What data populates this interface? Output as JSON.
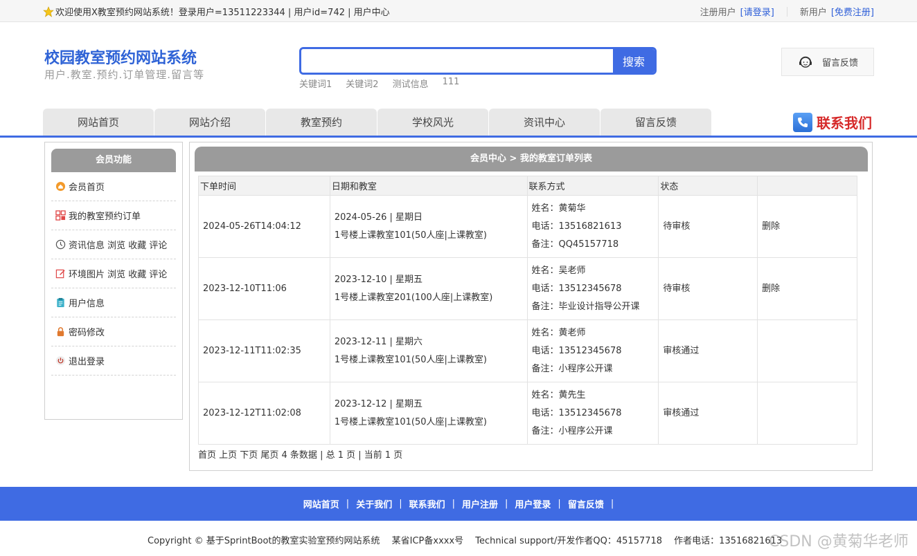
{
  "topbar": {
    "welcome": "欢迎使用X教室预约网站系统！登录用户=13511223344 | 用户id=742 | 用户中心",
    "register_user_label": "注册用户",
    "login_link": "[请登录]",
    "new_user_label": "新用户",
    "register_link": "[免费注册]"
  },
  "header": {
    "title": "校园教室预约网站系统",
    "subtitle": "用户.教室.预约.订单管理.留言等",
    "search": {
      "placeholder": "",
      "button": "搜索"
    },
    "keywords": [
      "关键词1",
      "关键词2",
      "测试信息",
      "111"
    ],
    "feedback": "留言反馈"
  },
  "nav": {
    "items": [
      "网站首页",
      "网站介绍",
      "教室预约",
      "学校风光",
      "资讯中心",
      "留言反馈"
    ],
    "contact": "联系我们"
  },
  "sidebar": {
    "title": "会员功能",
    "items": [
      {
        "label": "会员首页",
        "icon": "home-icon"
      },
      {
        "label": "我的教室预约订单",
        "icon": "orders-icon"
      },
      {
        "label": "资讯信息 浏览 收藏 评论",
        "icon": "clock-icon"
      },
      {
        "label": "环境图片 浏览 收藏 评论",
        "icon": "edit-icon"
      },
      {
        "label": "用户信息",
        "icon": "clipboard-icon"
      },
      {
        "label": "密码修改",
        "icon": "lock-icon"
      },
      {
        "label": "退出登录",
        "icon": "power-icon"
      }
    ]
  },
  "main": {
    "title": "会员中心 > 我的教室订单列表",
    "columns": [
      "下单时间",
      "日期和教室",
      "联系方式",
      "状态",
      ""
    ],
    "rows": [
      {
        "time": "2024-05-26T14:04:12",
        "date": "2024-05-26 | 星期日",
        "room": "1号楼上课教室101(50人座|上课教室)",
        "name": "姓名：黄菊华",
        "phone": "电话：13516821613",
        "note": "备注：QQ45157718",
        "status": "待审核",
        "action": "删除"
      },
      {
        "time": "2023-12-10T11:06",
        "date": "2023-12-10 | 星期五",
        "room": "1号楼上课教室201(100人座|上课教室)",
        "name": "姓名：吴老师",
        "phone": "电话：13512345678",
        "note": "备注：毕业设计指导公开课",
        "status": "待审核",
        "action": "删除"
      },
      {
        "time": "2023-12-11T11:02:35",
        "date": "2023-12-11 | 星期六",
        "room": "1号楼上课教室101(50人座|上课教室)",
        "name": "姓名：黄老师",
        "phone": "电话：13512345678",
        "note": "备注：小程序公开课",
        "status": "审核通过",
        "action": ""
      },
      {
        "time": "2023-12-12T11:02:08",
        "date": "2023-12-12 | 星期五",
        "room": "1号楼上课教室101(50人座|上课教室)",
        "name": "姓名：黄先生",
        "phone": "电话：13512345678",
        "note": "备注：小程序公开课",
        "status": "审核通过",
        "action": ""
      }
    ],
    "pager": "首页 上页 下页 尾页 4 条数据 | 总 1 页 | 当前 1 页"
  },
  "footer": {
    "links": [
      "网站首页",
      "关于我们",
      "联系我们",
      "用户注册",
      "用户登录",
      "留言反馈"
    ],
    "copyright": "Copyright © 基于SprintBoot的教室实验室预约网站系统　 某省ICP备xxxx号　 Technical support/开发作者QQ：45157718　 作者电话：13516821613",
    "watermark": "CSDN @黄菊华老师"
  },
  "colors": {
    "accent": "#3f6be3",
    "pending": "#d61f1f",
    "header_gray": "#9b9b9b"
  }
}
